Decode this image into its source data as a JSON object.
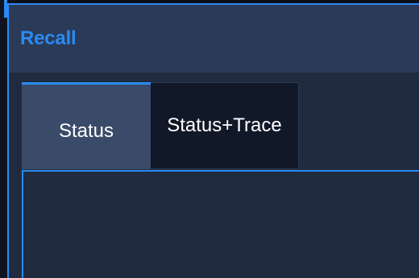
{
  "dialog": {
    "title": "Recall",
    "tabs": [
      {
        "label": "Status",
        "active": true
      },
      {
        "label": "Status+Trace",
        "active": false
      }
    ]
  },
  "colors": {
    "accent": "#2a8bf2",
    "header_bg": "#2b3a57",
    "panel_bg": "#202b3f",
    "active_tab_bg": "#3a4b69",
    "inactive_tab_bg": "#111827"
  }
}
